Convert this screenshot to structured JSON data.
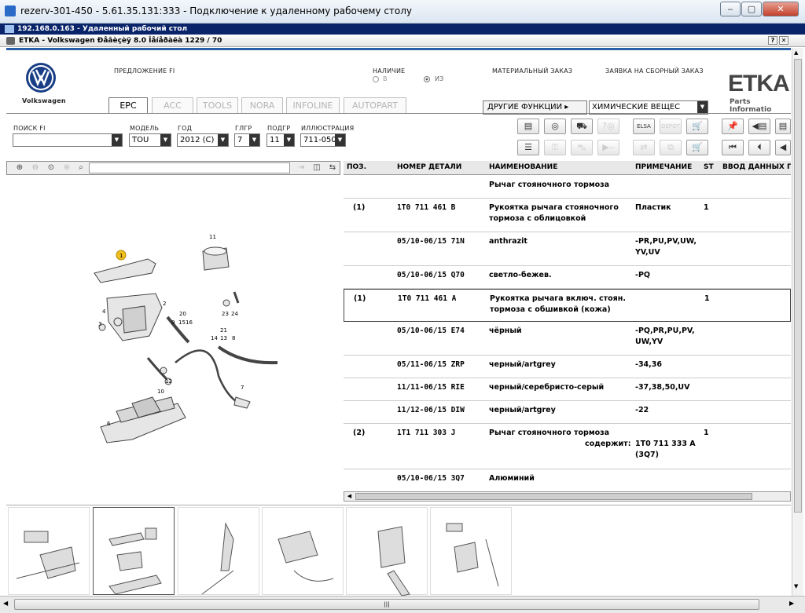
{
  "window": {
    "title": "rezerv-301-450 - 5.61.35.131:333 - Подключение к удаленному рабочему столу",
    "minimize": "‒",
    "maximize": "▢",
    "close": "✕"
  },
  "rdp": {
    "title": "192.168.0.163 - Удаленный рабочий стол"
  },
  "etka_window": {
    "title": "ETKA - Volkswagen Ðåâèçèÿ 8.0 Îåíåðàëà 1229 / 70",
    "help": "?",
    "close": "✕"
  },
  "header": {
    "brand": "Volkswagen",
    "offer": "ПРЕДЛОЖЕНИЕ FI",
    "availability": {
      "label": "НАЛИЧИЕ",
      "opt1": "В",
      "opt2": "ИЗ"
    },
    "material_order": "МАТЕРИАЛЬНЫЙ ЗАКАЗ",
    "assembly_order": "ЗАЯВКА НА СБОРНЫЙ ЗАКАЗ",
    "etka_logo": "ETKA",
    "etka_sub": "Parts Informatio",
    "other_functions": "ДРУГИЕ ФУНКЦИИ",
    "chemicals": "ХИМИЧЕСКИЕ ВЕЩЕС"
  },
  "tabs": [
    "EPC",
    "ACC",
    "TOOLS",
    "NORA",
    "INFOLINE",
    "AUTOPART"
  ],
  "filters": {
    "search_label": "ПОИСК FI",
    "search_value": "",
    "model_label": "МОДЕЛЬ",
    "model_value": "TOU",
    "year_label": "ГОД",
    "year_value": "2012 (C)",
    "glgr_label": "ГЛГР",
    "glgr_value": "7",
    "podgr_label": "ПОДГР",
    "podgr_value": "11",
    "illus_label": "ИЛЛЮСТРАЦИЯ",
    "illus_value": "711-050"
  },
  "grid": {
    "columns": [
      "ПОЗ.",
      "НОМЕР ДЕТАЛИ",
      "НАИМЕНОВАНИЕ",
      "ПРИМЕЧАНИЕ",
      "ST",
      "ВВОД ДАННЫХ П"
    ],
    "rows": [
      {
        "pos": "",
        "num": "",
        "name": "Рычаг стояночного тормоза",
        "note": "",
        "st": ""
      },
      {
        "pos": "(1)",
        "num": "1T0 711 461 B",
        "name": "Рукоятка рычага стояночного тормоза с облицовкой",
        "note": "Пластик",
        "st": "1"
      },
      {
        "pos": "",
        "num": "05/10-06/15 71N",
        "name": "anthrazit",
        "note": "-PR,PU,PV,UW, YV,UV",
        "st": ""
      },
      {
        "pos": "",
        "num": "05/10-06/15 Q70",
        "name": "светло-бежев.",
        "note": "-PQ",
        "st": ""
      },
      {
        "pos": "(1)",
        "num": "1T0 711 461 A",
        "name": "Рукоятка рычага включ. стоян. тормоза с обшивкой (кожа)",
        "note": "",
        "st": "1"
      },
      {
        "pos": "",
        "num": "05/10-06/15 E74",
        "name": "чёрный",
        "note": "-PQ,PR,PU,PV, UW,YV",
        "st": ""
      },
      {
        "pos": "",
        "num": "05/11-06/15 ZRP",
        "name": "черный/artgrey",
        "note": "-34,36",
        "st": ""
      },
      {
        "pos": "",
        "num": "11/11-06/15 RIE",
        "name": "черный/серебристо-серый",
        "note": "-37,38,50,UV",
        "st": ""
      },
      {
        "pos": "",
        "num": "11/12-06/15 DIW",
        "name": "черный/artgrey",
        "note": "-22",
        "st": ""
      },
      {
        "pos": "(2)",
        "num": "1T1 711 303 J",
        "name": "Рычаг стояночного тормоза",
        "note": "",
        "st": "1",
        "contains_label": "содержит:",
        "contains_value": "1T0 711 333 A (3Q7)"
      },
      {
        "pos": "",
        "num": "05/10-06/15 3Q7",
        "name": "Алюминий",
        "note": "",
        "st": ""
      }
    ]
  },
  "illustration": {
    "labels": [
      "1",
      "11",
      "2",
      "3",
      "4",
      "20",
      "9",
      "15",
      "16",
      "23",
      "24",
      "21",
      "14",
      "13",
      "8",
      "7",
      "12",
      "10",
      "6"
    ]
  }
}
